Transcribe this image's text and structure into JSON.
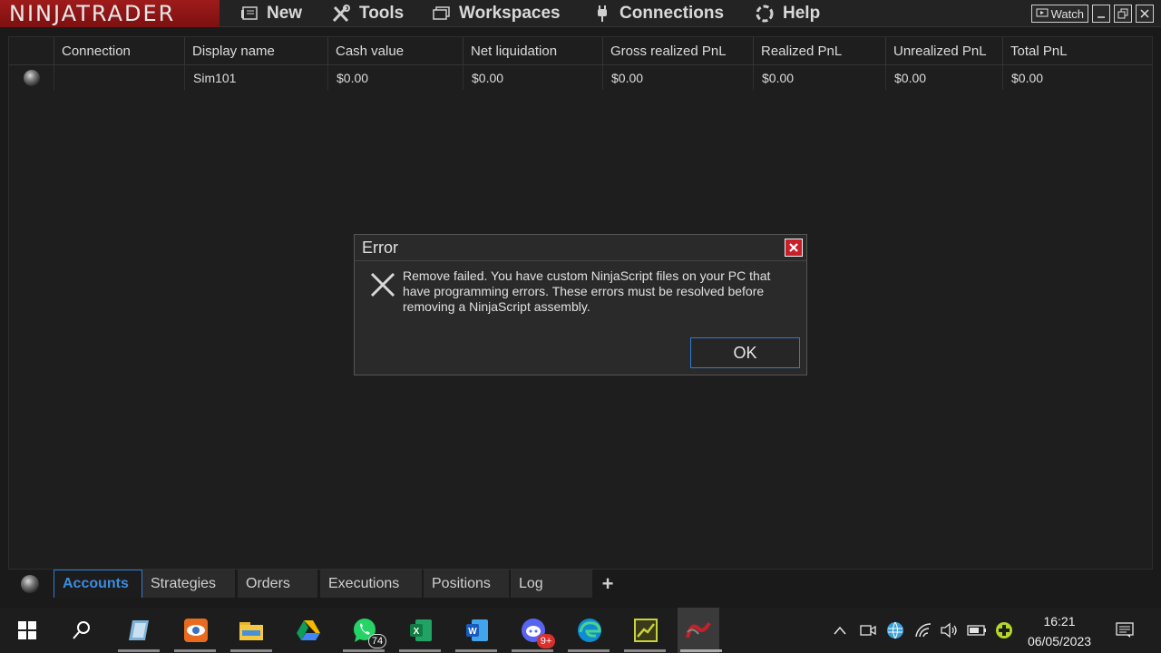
{
  "app": {
    "logo_text": "NINJATRADER",
    "menu": [
      "New",
      "Tools",
      "Workspaces",
      "Connections",
      "Help"
    ],
    "watch_label": "Watch"
  },
  "grid": {
    "columns": [
      "",
      "Connection",
      "Display name",
      "Cash value",
      "Net liquidation",
      "Gross realized PnL",
      "Realized PnL",
      "Unrealized PnL",
      "Total PnL"
    ],
    "rows": [
      {
        "connection": "",
        "display_name": "Sim101",
        "cash_value": "$0.00",
        "net_liquidation": "$0.00",
        "gross_realized_pnl": "$0.00",
        "realized_pnl": "$0.00",
        "unrealized_pnl": "$0.00",
        "total_pnl": "$0.00"
      }
    ]
  },
  "dialog": {
    "title": "Error",
    "message": "Remove failed. You have custom NinjaScript files on your PC that have programming errors. These errors must be resolved before removing a NinjaScript assembly.",
    "ok_label": "OK"
  },
  "tabs": [
    "Accounts",
    "Strategies",
    "Orders",
    "Executions",
    "Positions",
    "Log",
    "+"
  ],
  "taskbar": {
    "whatsapp_badge": "74",
    "discord_badge": "9+",
    "time": "16:21",
    "date": "06/05/2023"
  },
  "colors": {
    "accent": "#2d7bd6",
    "logo_bg": "#9e1b1b",
    "close_red": "#c8202a"
  }
}
